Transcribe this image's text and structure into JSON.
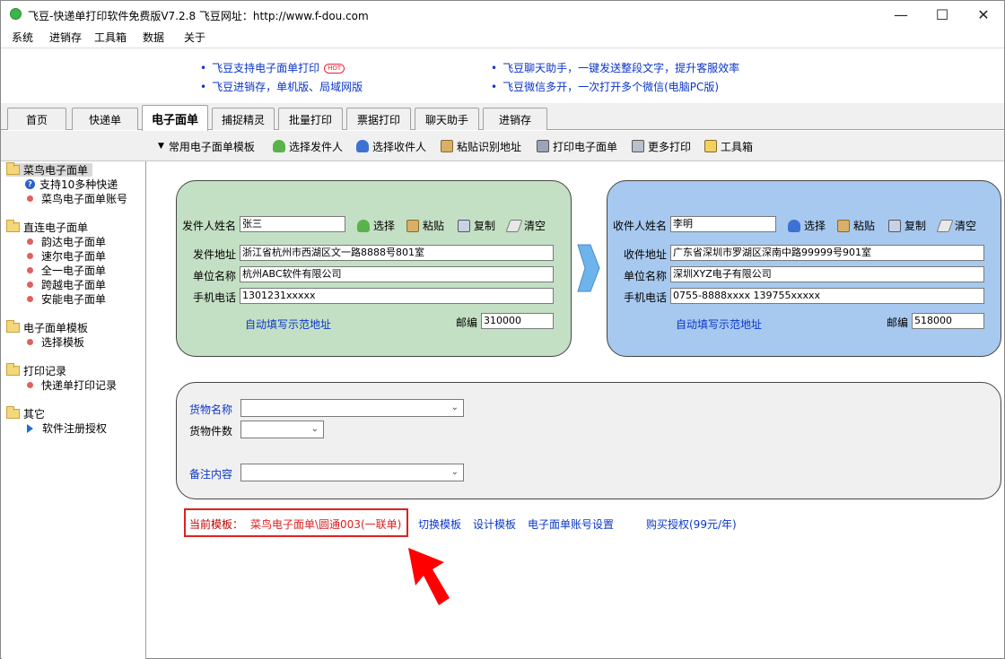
{
  "window": {
    "title": "飞豆-快递单打印软件免费版V7.2.8  飞豆网址：http://www.f-dou.com",
    "minimize": "—",
    "maximize": "☐",
    "close": "✕"
  },
  "menu": [
    "系统",
    "进销存",
    "工具箱",
    "数据",
    "关于"
  ],
  "ads": {
    "left": [
      "飞豆支持电子面单打印",
      "飞豆进销存，单机版、局域网版"
    ],
    "hot_badge": "HOT",
    "right": [
      "飞豆聊天助手，一键发送整段文字，提升客服效率",
      "飞豆微信多开，一次打开多个微信(电脑PC版)"
    ]
  },
  "tabs": [
    "首页",
    "快递单",
    "电子面单",
    "捕捉精灵",
    "批量打印",
    "票据打印",
    "聊天助手",
    "进销存"
  ],
  "active_tab": "电子面单",
  "toolbar": [
    "常用电子面单模板",
    "选择发件人",
    "选择收件人",
    "粘贴识别地址",
    "打印电子面单",
    "更多打印",
    "工具箱"
  ],
  "sidebar": {
    "groups": [
      {
        "label": "菜鸟电子面单",
        "items": [
          "支持10多种快递",
          "菜鸟电子面单账号"
        ]
      },
      {
        "label": "直连电子面单",
        "items": [
          "韵达电子面单",
          "速尔电子面单",
          "全一电子面单",
          "跨越电子面单",
          "安能电子面单"
        ]
      },
      {
        "label": "电子面单模板",
        "items": [
          "选择模板"
        ]
      },
      {
        "label": "打印记录",
        "items": [
          "快递单打印记录"
        ]
      },
      {
        "label": "其它",
        "items": [
          "软件注册授权"
        ]
      }
    ]
  },
  "sender": {
    "name_label": "发件人姓名",
    "name": "张三",
    "address_label": "发件地址",
    "address": "浙江省杭州市西湖区文一路8888号801室",
    "company_label": "单位名称",
    "company": "杭州ABC软件有限公司",
    "phone_label": "手机电话",
    "phone": "1301231xxxxx",
    "autofill": "自动填写示范地址",
    "zip_label": "邮编",
    "zip": "310000"
  },
  "receiver": {
    "name_label": "收件人姓名",
    "name": "李明",
    "address_label": "收件地址",
    "address": "广东省深圳市罗湖区深南中路99999号901室",
    "company_label": "单位名称",
    "company": "深圳XYZ电子有限公司",
    "phone_label": "手机电话",
    "phone": "0755-8888xxxx 139755xxxxx",
    "autofill": "自动填写示范地址",
    "zip_label": "邮编",
    "zip": "518000"
  },
  "actions": {
    "select": "选择",
    "paste": "粘贴",
    "copy": "复制",
    "clear": "清空"
  },
  "goods": {
    "name_label": "货物名称",
    "count_label": "货物件数",
    "note_label": "备注内容"
  },
  "template": {
    "label": "当前模板：",
    "value": "菜鸟电子面单\\圆通003(一联单)",
    "switch": "切换模板",
    "design": "设计模板",
    "account": "电子面单账号设置",
    "buy": "购买授权(99元/年)"
  },
  "colors": {
    "sender_panel": "#c4e0c4",
    "receiver_panel": "#a7c9ef",
    "link": "#0b36c8",
    "highlight": "#e02020"
  }
}
